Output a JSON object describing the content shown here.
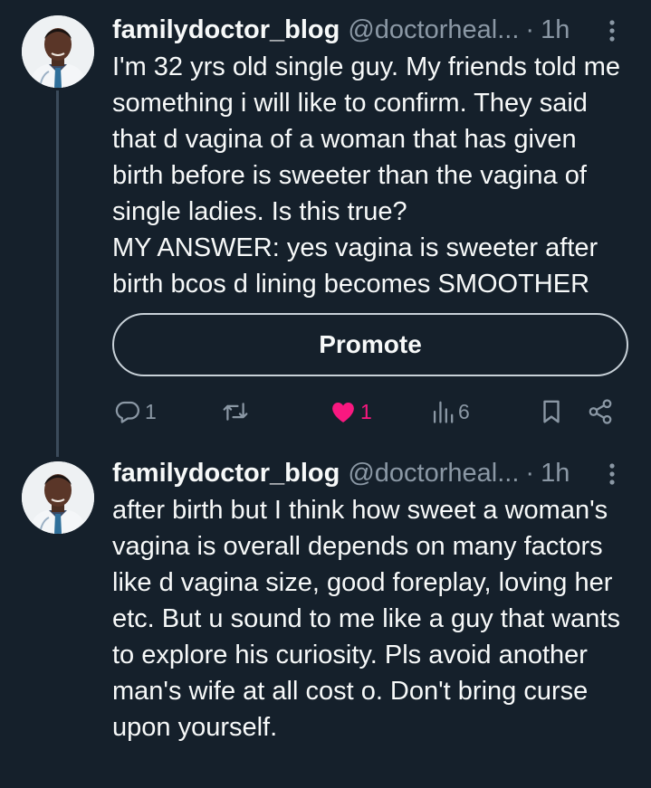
{
  "tweets": [
    {
      "name": "familydoctor_blog",
      "handle": "@doctorheal...",
      "dot": "·",
      "time": "1h",
      "text": "I'm 32 yrs old single guy. My friends told me something i will like to confirm. They said that d vagina of a woman that has given birth before is sweeter than the vagina of single ladies. Is this true?\nMY ANSWER: yes vagina is sweeter after birth bcos d lining becomes SMOOTHER",
      "promote_label": "Promote",
      "replies": "1",
      "likes": "1",
      "views": "6"
    },
    {
      "name": "familydoctor_blog",
      "handle": "@doctorheal...",
      "dot": "·",
      "time": "1h",
      "text": "after birth but I think how sweet a woman's vagina is overall depends on many factors like d vagina size, good foreplay, loving her etc. But u sound to me like a guy that wants to explore his curiosity. Pls avoid another man's wife at all cost o. Don't bring curse upon yourself."
    }
  ],
  "colors": {
    "background": "#15202b",
    "text": "#f7f9f9",
    "secondary": "#8b98a5",
    "like": "#f91880",
    "thread_line": "#3b4b5b"
  },
  "icons": [
    "avatar",
    "more-icon",
    "reply-icon",
    "retweet-icon",
    "heart-icon",
    "views-icon",
    "bookmark-icon",
    "share-icon"
  ]
}
